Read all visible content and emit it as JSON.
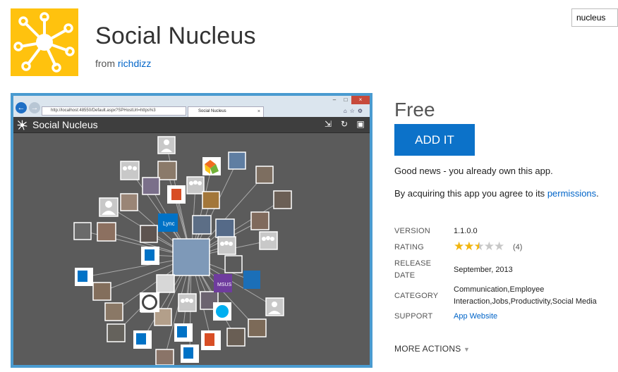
{
  "search": {
    "value": "nucleus"
  },
  "app": {
    "title": "Social Nucleus",
    "from_prefix": "from",
    "publisher": "richdizz"
  },
  "screenshot": {
    "url": "http://localhost:48550/Default.aspx?SPHostUrl=https%3",
    "tab_title": "Social Nucleus",
    "app_title": "Social Nucleus",
    "tile_labels": [
      "Lync",
      "MSUS"
    ]
  },
  "pricing": {
    "price": "Free",
    "add_label": "ADD IT",
    "own_message": "Good news - you already own this app.",
    "agree_prefix": "By acquiring this app you agree to its",
    "permissions_link": "permissions",
    "agree_suffix": "."
  },
  "details": {
    "version_label": "VERSION",
    "version": "1.1.0.0",
    "rating_label": "RATING",
    "rating_value": 2.5,
    "rating_max": 5,
    "rating_count": "(4)",
    "release_label_1": "RELEASE",
    "release_label_2": "DATE",
    "release_date": "September, 2013",
    "category_label": "CATEGORY",
    "category_line_1": "Communication,Employee",
    "category_line_2": "Interaction,Jobs,Productivity,Social Media",
    "support_label": "SUPPORT",
    "support_link": "App Website"
  },
  "more_actions": "MORE ACTIONS",
  "colors": {
    "logo_bg": "#ffc20e",
    "accent": "#0c72c9",
    "link": "#0064c8",
    "star_on": "#f1b50f",
    "star_off": "#c7c7c7"
  }
}
